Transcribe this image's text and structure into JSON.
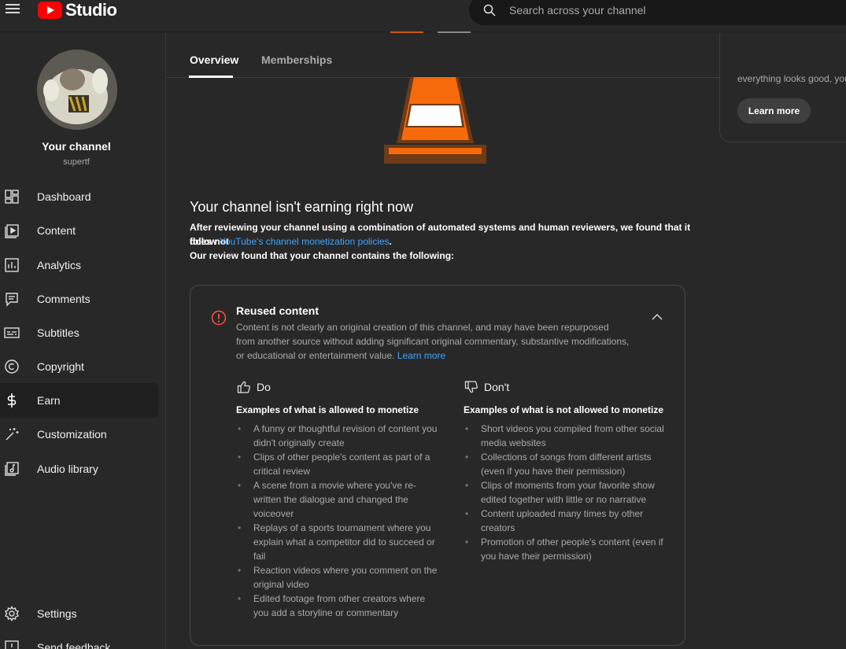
{
  "app": {
    "logo_text": "Studio"
  },
  "search": {
    "placeholder": "Search across your channel"
  },
  "channel": {
    "title": "Your channel",
    "handle": "supertf"
  },
  "sidebar": {
    "items": [
      {
        "label": "Dashboard",
        "icon": "dashboard-icon"
      },
      {
        "label": "Content",
        "icon": "content-icon"
      },
      {
        "label": "Analytics",
        "icon": "analytics-icon"
      },
      {
        "label": "Comments",
        "icon": "comments-icon"
      },
      {
        "label": "Subtitles",
        "icon": "subtitles-icon"
      },
      {
        "label": "Copyright",
        "icon": "copyright-icon"
      },
      {
        "label": "Earn",
        "icon": "dollar-icon",
        "active": true
      },
      {
        "label": "Customization",
        "icon": "magic-wand-icon"
      },
      {
        "label": "Audio library",
        "icon": "audio-library-icon"
      }
    ],
    "bottom": [
      {
        "label": "Settings",
        "icon": "gear-icon"
      },
      {
        "label": "Send feedback",
        "icon": "feedback-icon"
      }
    ]
  },
  "tabs": {
    "overview": "Overview",
    "memberships": "Memberships"
  },
  "right_panel": {
    "text": "everything looks good, you",
    "button": "Learn more"
  },
  "status": {
    "heading": "Your channel isn't earning right now",
    "line1": "After reviewing your channel using a combination of automated systems and human reviewers, we found that it does not",
    "line2_prefix": "follow ",
    "policy_link": "YouTube's channel monetization policies",
    "line2_suffix": ".",
    "line3": "Our review found that your channel contains the following:"
  },
  "issue": {
    "title": "Reused content",
    "description": "Content is not clearly an original creation of this channel, and may have been repurposed from another source without adding significant original commentary, substantive modifications, or educational or entertainment value.",
    "learn_more": "Learn more",
    "do": {
      "label": "Do",
      "subtitle": "Examples of what is allowed to monetize",
      "items": [
        "A funny or thoughtful revision of content you didn't originally create",
        "Clips of other people's content as part of a critical review",
        "A scene from a movie where you've re-written the dialogue and changed the voiceover",
        "Replays of a sports tournament where you explain what a competitor did to succeed or fail",
        "Reaction videos where you comment on the original video",
        "Edited footage from other creators where you add a storyline or commentary"
      ]
    },
    "dont": {
      "label": "Don't",
      "subtitle": "Examples of what is not allowed to monetize",
      "items": [
        "Short videos you compiled from other social media websites",
        "Collections of songs from different artists (even if you have their permission)",
        "Clips of moments from your favorite show edited together with little or no narrative",
        "Content uploaded many times by other creators",
        "Promotion of other people's content (even if you have their permission)"
      ]
    }
  },
  "colors": {
    "accent": "#ff0000",
    "link": "#3ea6ff",
    "warning": "#ff4e45",
    "cone": "#f76a0c"
  }
}
